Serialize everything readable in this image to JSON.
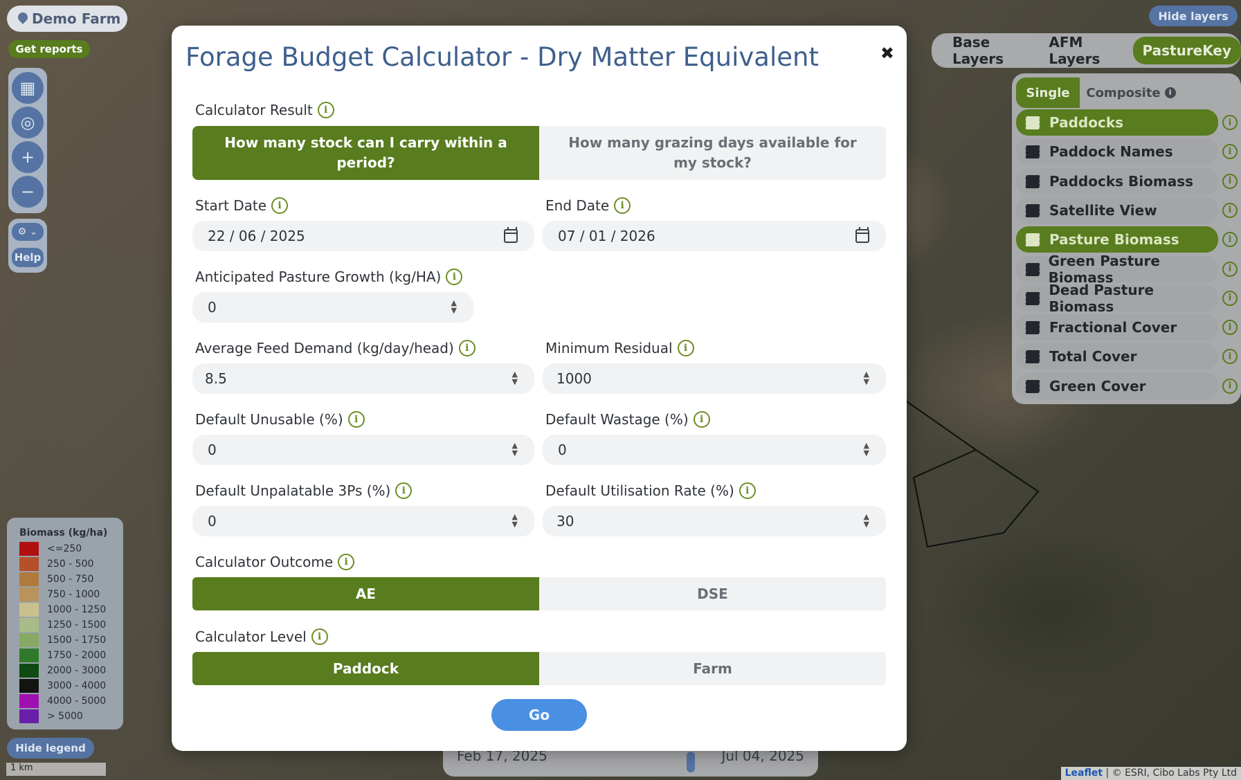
{
  "map": {
    "farm_name": "Demo Farm",
    "get_reports": "Get reports",
    "help": "Help",
    "hide_legend": "Hide legend",
    "hide_layers": "Hide layers",
    "scale": "1 km",
    "timeline": {
      "start": "Feb 17, 2025",
      "end": "Jul 04, 2025"
    },
    "attribution": {
      "leaflet": "Leaflet",
      "rest": "| © ESRI, Cibo Labs Pty Ltd"
    },
    "controls": [
      "map-icon",
      "locate-icon",
      "zoom-in-icon",
      "zoom-out-icon"
    ]
  },
  "legend": {
    "title": "Biomass (kg/ha)",
    "items": [
      {
        "label": "<=250",
        "color": "#b01010"
      },
      {
        "label": "250 - 500",
        "color": "#b4502a"
      },
      {
        "label": "500 - 750",
        "color": "#b07a3c"
      },
      {
        "label": "750 - 1000",
        "color": "#b8935c"
      },
      {
        "label": "1000 - 1250",
        "color": "#c9c090"
      },
      {
        "label": "1250 - 1500",
        "color": "#a9bb88"
      },
      {
        "label": "1500 - 1750",
        "color": "#86a964"
      },
      {
        "label": "1750 - 2000",
        "color": "#2f7a2a"
      },
      {
        "label": "2000 - 3000",
        "color": "#0f4a12"
      },
      {
        "label": "3000 - 4000",
        "color": "#111411"
      },
      {
        "label": "4000 - 5000",
        "color": "#a010b0"
      },
      {
        "label": "> 5000",
        "color": "#6a1fa8"
      }
    ]
  },
  "layers": {
    "tabs": [
      {
        "label": "Base Layers",
        "active": false
      },
      {
        "label": "AFM Layers",
        "active": false
      },
      {
        "label": "PastureKey",
        "active": true
      }
    ],
    "single": "Single",
    "composite": "Composite",
    "items": [
      {
        "label": "Paddocks",
        "on": true
      },
      {
        "label": "Paddock Names",
        "on": false
      },
      {
        "label": "Paddocks Biomass",
        "on": false
      },
      {
        "label": "Satellite View",
        "on": false
      },
      {
        "label": "Pasture Biomass",
        "on": true
      },
      {
        "label": "Green Pasture Biomass",
        "on": false
      },
      {
        "label": "Dead Pasture Biomass",
        "on": false
      },
      {
        "label": "Fractional Cover",
        "on": false
      },
      {
        "label": "Total Cover",
        "on": false
      },
      {
        "label": "Green Cover",
        "on": false
      }
    ]
  },
  "modal": {
    "title": "Forage Budget Calculator - Dry Matter Equivalent",
    "calculator_result_label": "Calculator Result",
    "result_options": [
      {
        "label": "How many stock can I carry within a period?",
        "selected": true
      },
      {
        "label": "How many grazing days available for my stock?",
        "selected": false
      }
    ],
    "start_date_label": "Start Date",
    "start_date": "22 / 06 / 2025",
    "end_date_label": "End Date",
    "end_date": "07 / 01 / 2026",
    "growth_label": "Anticipated Pasture Growth (kg/HA)",
    "growth": "0",
    "feed_demand_label": "Average Feed Demand (kg/day/head)",
    "feed_demand": "8.5",
    "min_residual_label": "Minimum Residual",
    "min_residual": "1000",
    "unusable_label": "Default Unusable (%)",
    "unusable": "0",
    "wastage_label": "Default Wastage (%)",
    "wastage": "0",
    "unpalatable_label": "Default Unpalatable 3Ps (%)",
    "unpalatable": "0",
    "utilisation_label": "Default Utilisation Rate (%)",
    "utilisation": "30",
    "outcome_label": "Calculator Outcome",
    "outcome_options": [
      {
        "label": "AE",
        "selected": true
      },
      {
        "label": "DSE",
        "selected": false
      }
    ],
    "level_label": "Calculator Level",
    "level_options": [
      {
        "label": "Paddock",
        "selected": true
      },
      {
        "label": "Farm",
        "selected": false
      }
    ],
    "go": "Go",
    "colors": {
      "accent_green": "#587c1e",
      "title_blue": "#3e5f8c",
      "go_blue": "#4a90e2"
    }
  }
}
